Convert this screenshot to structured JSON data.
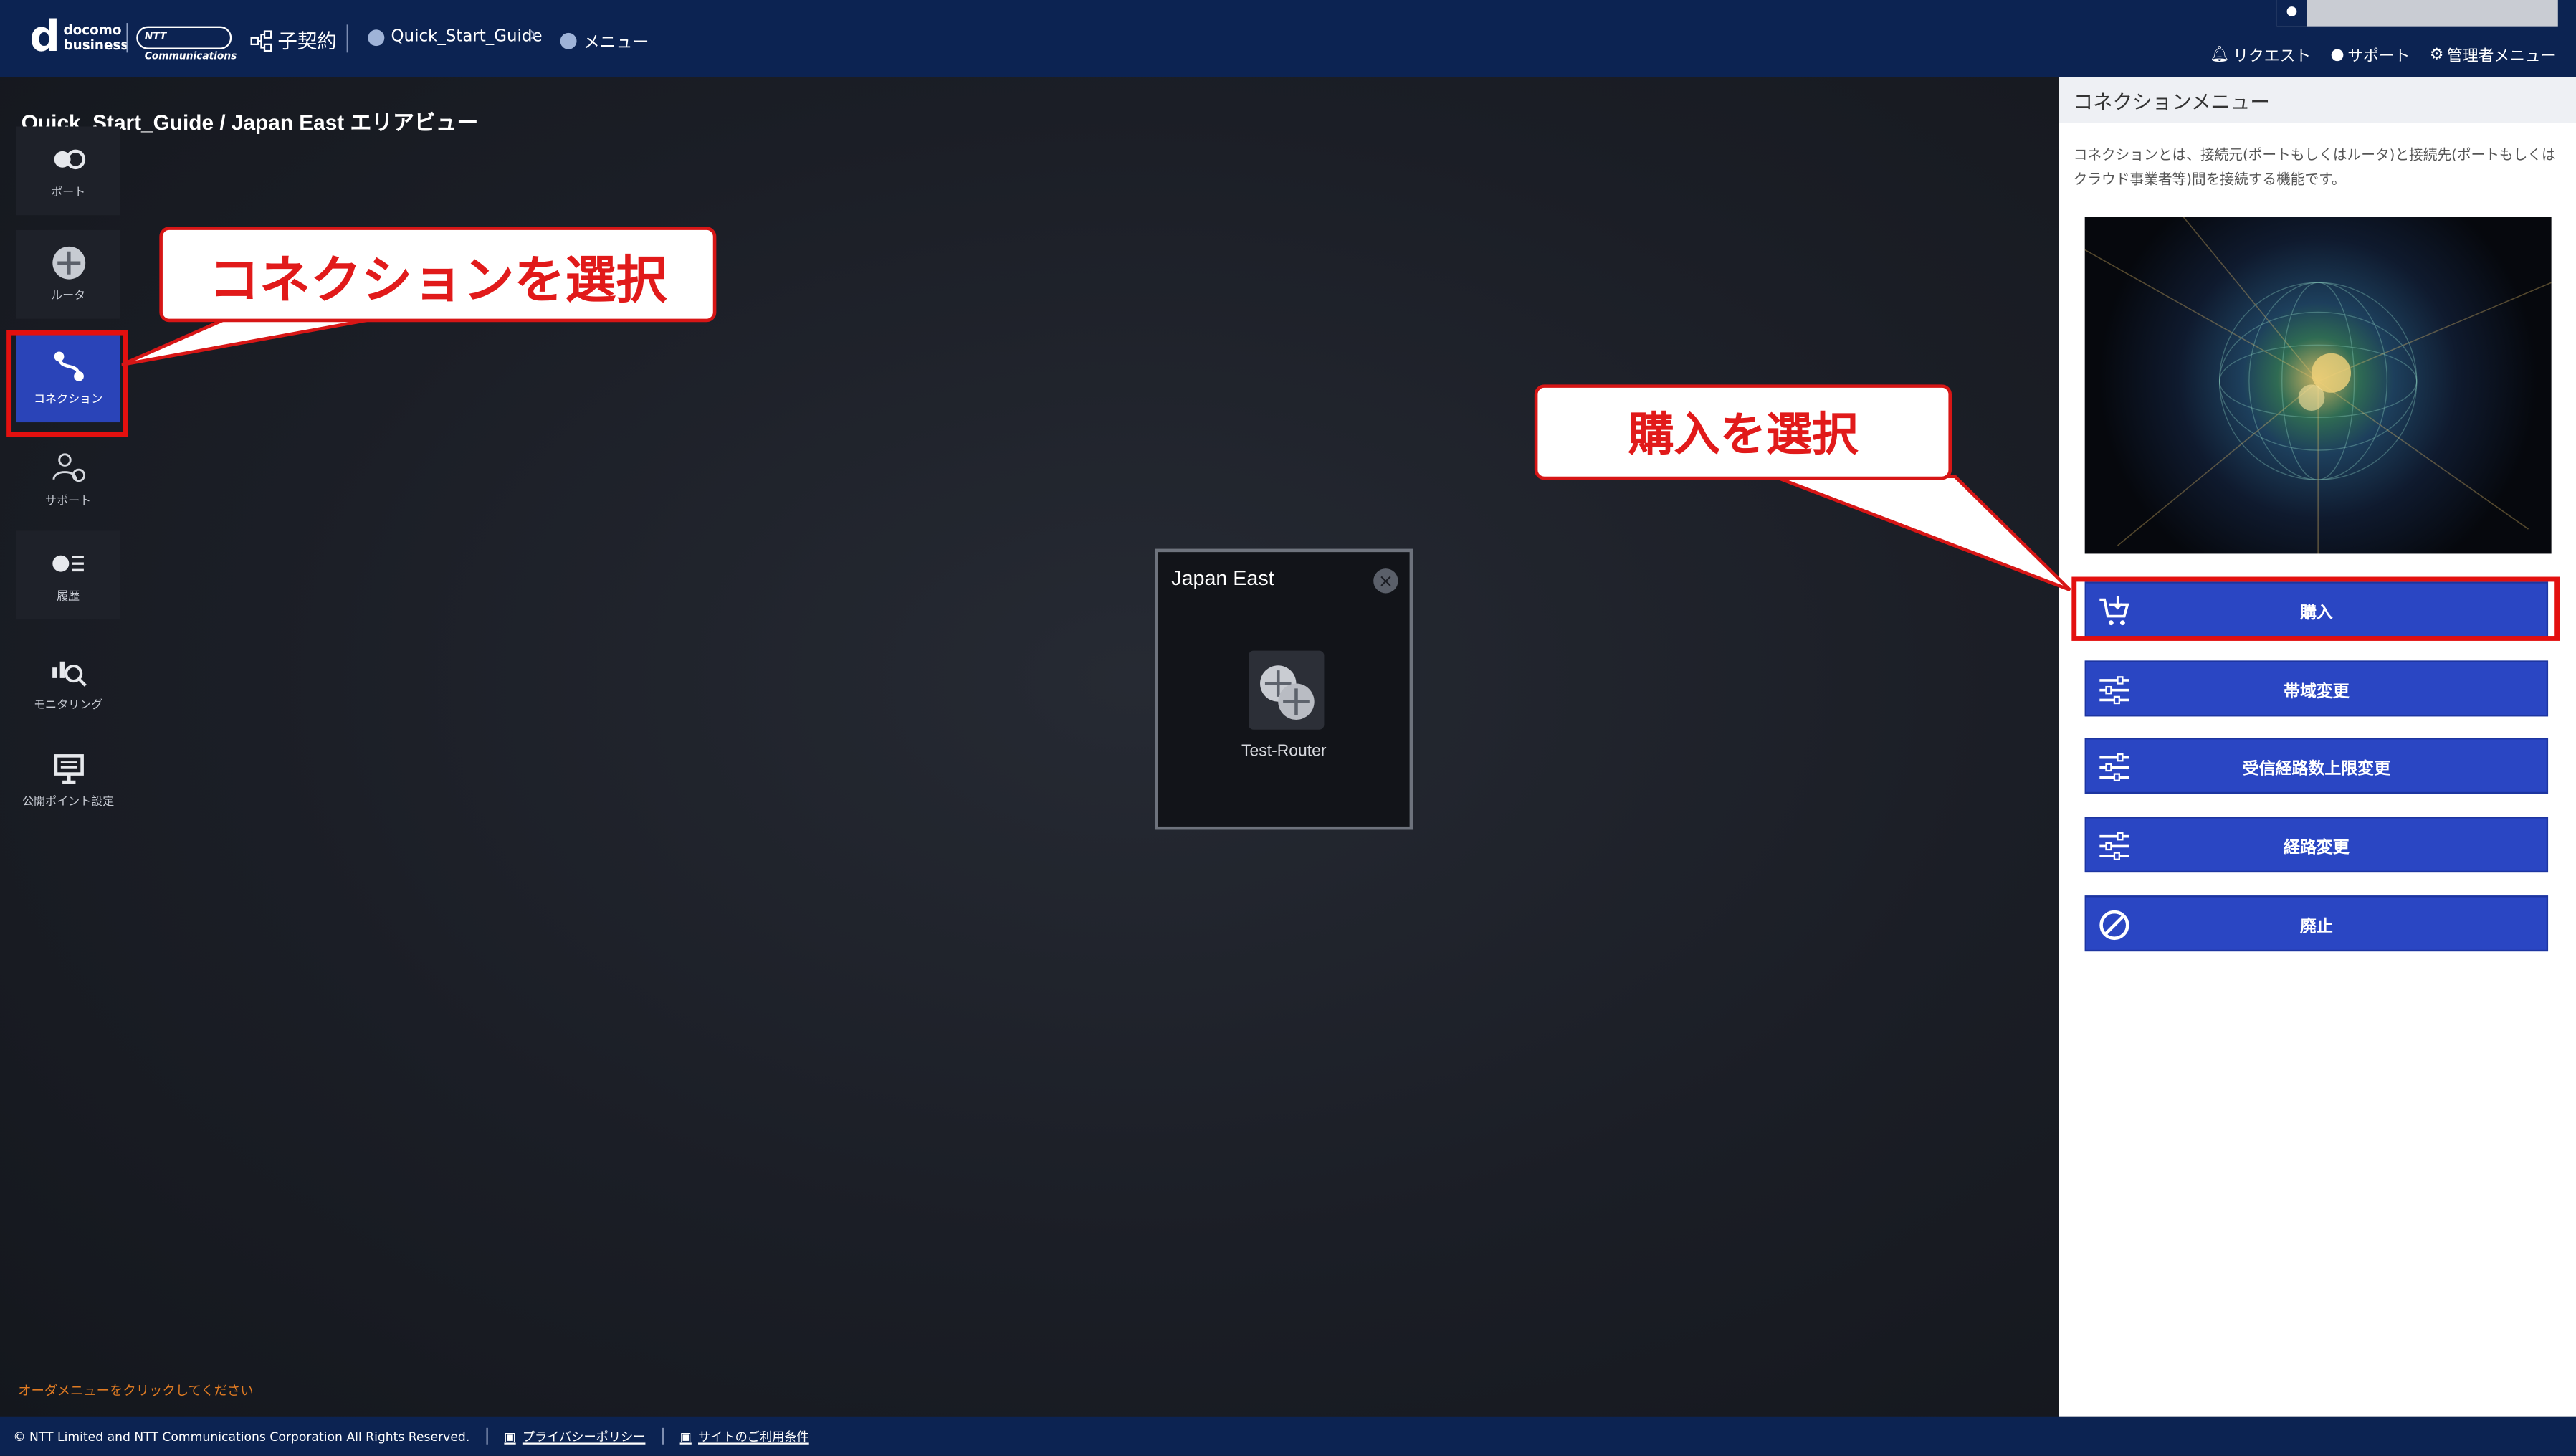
{
  "header": {
    "brand_d": "d",
    "brand_line1": "docomo",
    "brand_line2": "business",
    "ntt_logo": "NTT Communications",
    "contract_label": "子契約",
    "breadcrumb": [
      "Quick_Start_Guide",
      "メニュー"
    ],
    "links": [
      "リクエスト",
      "サポート",
      "管理者メニュー"
    ]
  },
  "main": {
    "area_title": "Quick_Start_Guide / Japan East エリアビュー",
    "order_hint": "オーダメニューをクリックしてください"
  },
  "sidebar": {
    "items": [
      {
        "label": "ポート",
        "icon": "port-icon"
      },
      {
        "label": "ルータ",
        "icon": "router-icon"
      },
      {
        "label": "コネクション",
        "icon": "connection-icon"
      },
      {
        "label": "サポート",
        "icon": "support-icon"
      },
      {
        "label": "履歴",
        "icon": "history-icon"
      },
      {
        "label": "モニタリング",
        "icon": "monitoring-icon"
      },
      {
        "label": "公開ポイント設定",
        "icon": "public-point-icon"
      }
    ]
  },
  "popup": {
    "title": "Japan East",
    "router_label": "Test-Router"
  },
  "panel": {
    "title": "コネクションメニュー",
    "description": "コネクションとは、接続元(ポートもしくはルータ)と接続先(ポートもしくはクラウド事業者等)間を接続する機能です。",
    "buttons": [
      {
        "label": "購入",
        "icon": "cart-icon"
      },
      {
        "label": "帯域変更",
        "icon": "sliders-icon"
      },
      {
        "label": "受信経路数上限変更",
        "icon": "sliders-icon"
      },
      {
        "label": "経路変更",
        "icon": "sliders-icon"
      },
      {
        "label": "廃止",
        "icon": "prohibit-icon"
      }
    ]
  },
  "annotations": {
    "callout_connection": "コネクションを選択",
    "callout_purchase": "購入を選択"
  },
  "footer": {
    "copyright": "© NTT Limited and NTT Communications Corporation All Rights Reserved.",
    "privacy": "プライバシーポリシー",
    "terms": "サイトのご利用条件"
  },
  "colors": {
    "header_bg": "#0c2352",
    "accent_button": "#2a46c3",
    "highlight_red": "#e3100f",
    "hint_orange": "#e07b23"
  }
}
